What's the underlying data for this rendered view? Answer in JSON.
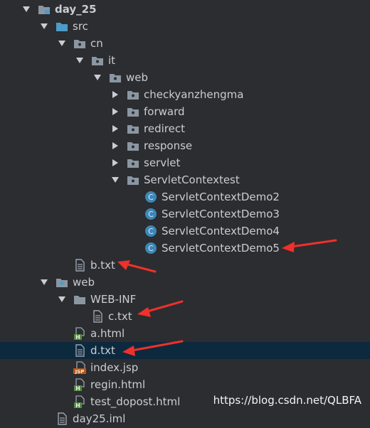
{
  "colors": {
    "background": "#2b2d30",
    "selected_row": "#0d293e",
    "text": "#c9cdd3",
    "folder": "#8b96a3",
    "source_folder": "#4d9bc9",
    "class_badge": "#3c87b8",
    "html_badge": "#4f8a3e",
    "jsp_badge": "#b3581d",
    "annotation_arrow": "#f0302a"
  },
  "tree": [
    {
      "label": "day_25",
      "depth": 0,
      "expanded": true,
      "icon": "module-folder-icon",
      "bold": true
    },
    {
      "label": "src",
      "depth": 1,
      "expanded": true,
      "icon": "source-folder-icon"
    },
    {
      "label": "cn",
      "depth": 2,
      "expanded": true,
      "icon": "package-icon"
    },
    {
      "label": "it",
      "depth": 3,
      "expanded": true,
      "icon": "package-icon"
    },
    {
      "label": "web",
      "depth": 4,
      "expanded": true,
      "icon": "package-icon"
    },
    {
      "label": "checkyanzhengma",
      "depth": 5,
      "expanded": false,
      "icon": "package-icon"
    },
    {
      "label": "forward",
      "depth": 5,
      "expanded": false,
      "icon": "package-icon"
    },
    {
      "label": "redirect",
      "depth": 5,
      "expanded": false,
      "icon": "package-icon"
    },
    {
      "label": "response",
      "depth": 5,
      "expanded": false,
      "icon": "package-icon"
    },
    {
      "label": "servlet",
      "depth": 5,
      "expanded": false,
      "icon": "package-icon"
    },
    {
      "label": "ServletContextest",
      "depth": 5,
      "expanded": true,
      "icon": "package-icon"
    },
    {
      "label": "ServletContextDemo2",
      "depth": 6,
      "icon": "class-icon"
    },
    {
      "label": "ServletContextDemo3",
      "depth": 6,
      "icon": "class-icon"
    },
    {
      "label": "ServletContextDemo4",
      "depth": 6,
      "icon": "class-icon"
    },
    {
      "label": "ServletContextDemo5",
      "depth": 6,
      "icon": "class-icon"
    },
    {
      "label": "b.txt",
      "depth": 2,
      "icon": "text-file-icon"
    },
    {
      "label": "web",
      "depth": 1,
      "expanded": true,
      "icon": "web-folder-icon"
    },
    {
      "label": "WEB-INF",
      "depth": 2,
      "expanded": true,
      "icon": "folder-icon"
    },
    {
      "label": "c.txt",
      "depth": 3,
      "icon": "text-file-icon"
    },
    {
      "label": "a.html",
      "depth": 2,
      "icon": "html-file-icon"
    },
    {
      "label": "d.txt",
      "depth": 2,
      "icon": "text-file-icon",
      "selected": true
    },
    {
      "label": "index.jsp",
      "depth": 2,
      "icon": "jsp-file-icon"
    },
    {
      "label": "regin.html",
      "depth": 2,
      "icon": "html-file-icon"
    },
    {
      "label": "test_dopost.html",
      "depth": 2,
      "icon": "html-file-icon"
    },
    {
      "label": "day25.iml",
      "depth": 1,
      "icon": "iml-file-icon"
    }
  ],
  "badges": {
    "class": "C",
    "html": "H",
    "jsp": "JSP"
  },
  "watermark": "https://blog.csdn.net/QLBFA"
}
